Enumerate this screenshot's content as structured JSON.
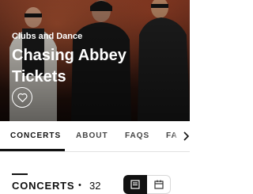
{
  "hero": {
    "category": "Clubs and Dance",
    "title": "Chasing Abbey Tickets"
  },
  "icons": {
    "favorite": "heart-icon",
    "next": "chevron-right-icon",
    "list_view": "list-icon",
    "calendar_view": "calendar-icon"
  },
  "tabs": [
    {
      "label": "CONCERTS",
      "active": true
    },
    {
      "label": "ABOUT",
      "active": false
    },
    {
      "label": "FAQS",
      "active": false
    },
    {
      "label": "FA",
      "active": false
    }
  ],
  "section": {
    "title": "CONCERTS",
    "separator": "•",
    "count": "32"
  },
  "colors": {
    "hero_overlay": "#3a1a12",
    "accent": "#111111",
    "background": "#ffffff"
  }
}
